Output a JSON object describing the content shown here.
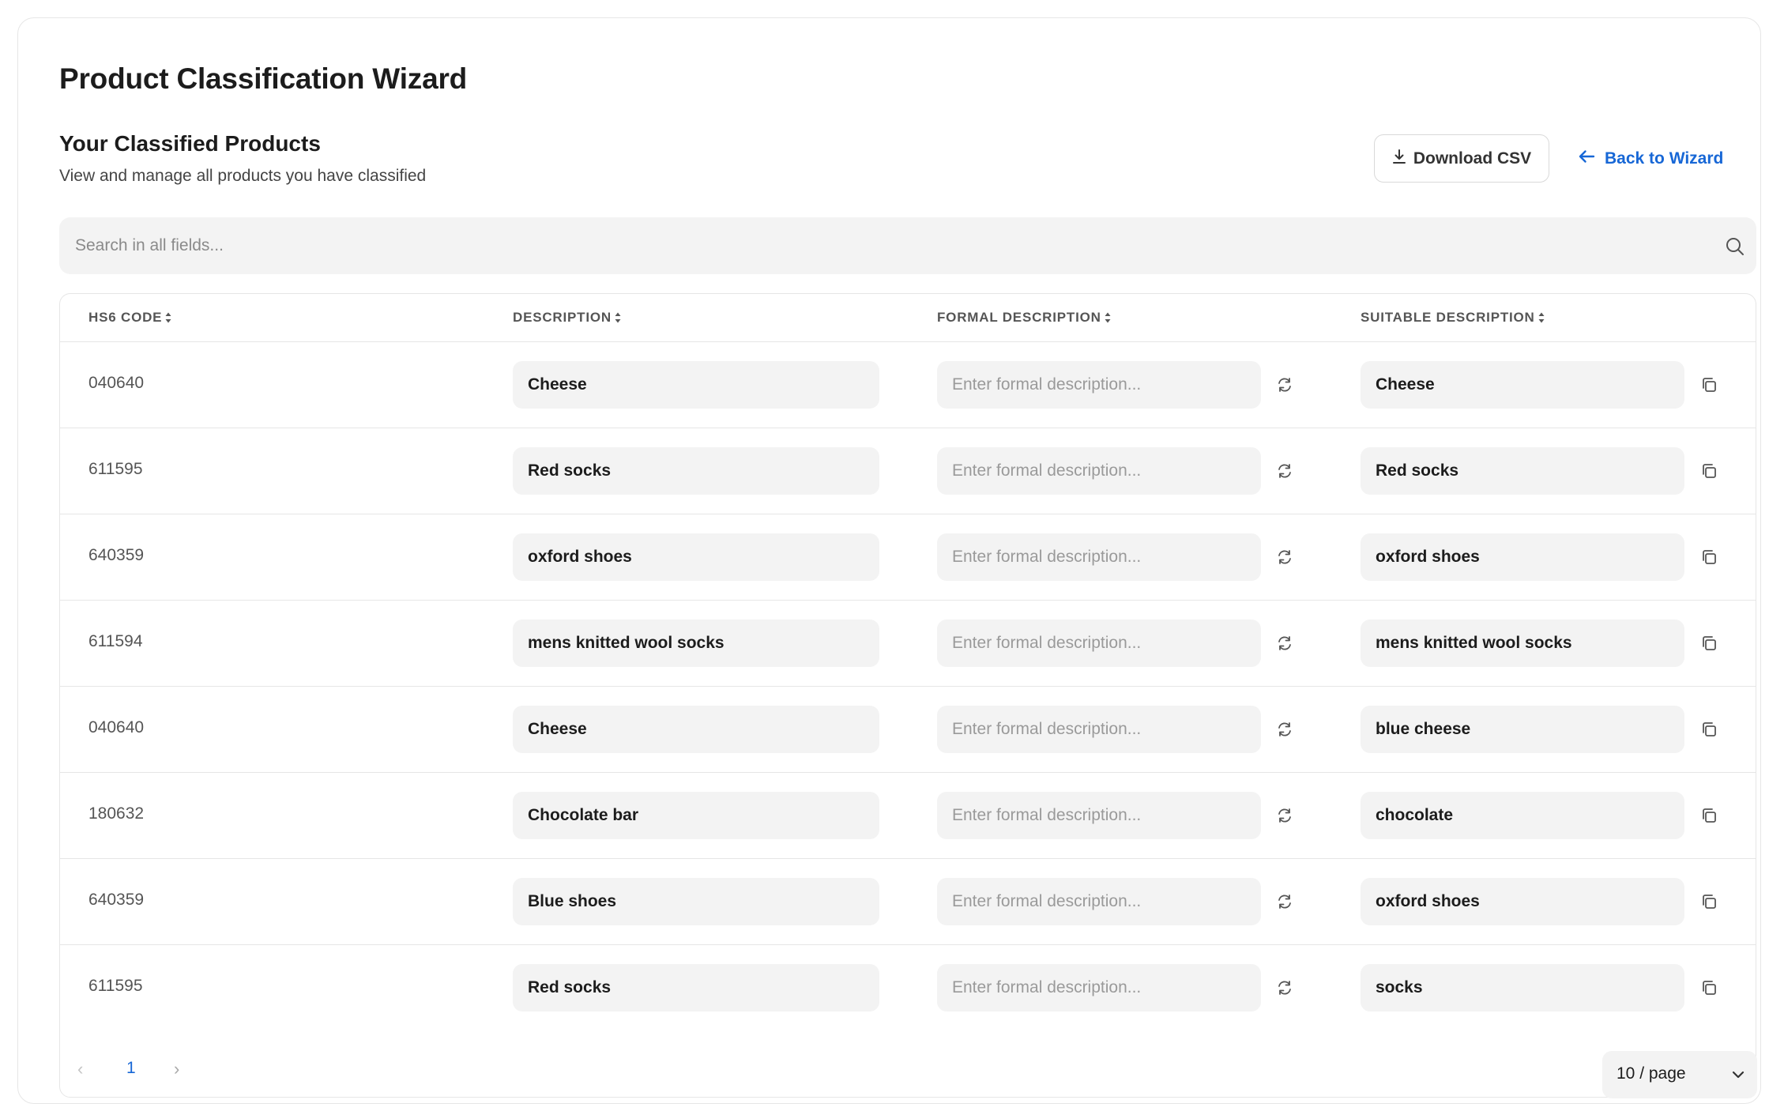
{
  "page": {
    "title": "Product Classification Wizard",
    "section_title": "Your Classified Products",
    "section_subtitle": "View and manage all products you have classified"
  },
  "actions": {
    "download_label": "Download CSV",
    "back_label": "Back to Wizard"
  },
  "search": {
    "placeholder": "Search in all fields...",
    "icon": "search-icon"
  },
  "table": {
    "headers": [
      "HS6 CODE",
      "DESCRIPTION",
      "FORMAL DESCRIPTION",
      "SUITABLE DESCRIPTION"
    ],
    "formal_placeholder": "Enter formal description...",
    "rows": [
      {
        "code": "040640",
        "description": "Cheese",
        "formal": "",
        "suitable": "Cheese"
      },
      {
        "code": "611595",
        "description": "Red socks",
        "formal": "",
        "suitable": "Red socks"
      },
      {
        "code": "640359",
        "description": "oxford shoes",
        "formal": "",
        "suitable": "oxford shoes"
      },
      {
        "code": "611594",
        "description": "mens knitted wool socks",
        "formal": "",
        "suitable": "mens knitted wool socks"
      },
      {
        "code": "040640",
        "description": "Cheese",
        "formal": "",
        "suitable": "blue cheese"
      },
      {
        "code": "180632",
        "description": "Chocolate bar",
        "formal": "",
        "suitable": "chocolate"
      },
      {
        "code": "640359",
        "description": "Blue shoes",
        "formal": "",
        "suitable": "oxford shoes"
      },
      {
        "code": "611595",
        "description": "Red socks",
        "formal": "",
        "suitable": "socks"
      }
    ]
  },
  "pagination": {
    "prev": "‹",
    "current": "1",
    "next": "›",
    "page_size": "10 / page"
  },
  "colors": {
    "accent": "#1767d6",
    "field_bg": "#f3f3f3",
    "border": "#e6e6e6"
  }
}
